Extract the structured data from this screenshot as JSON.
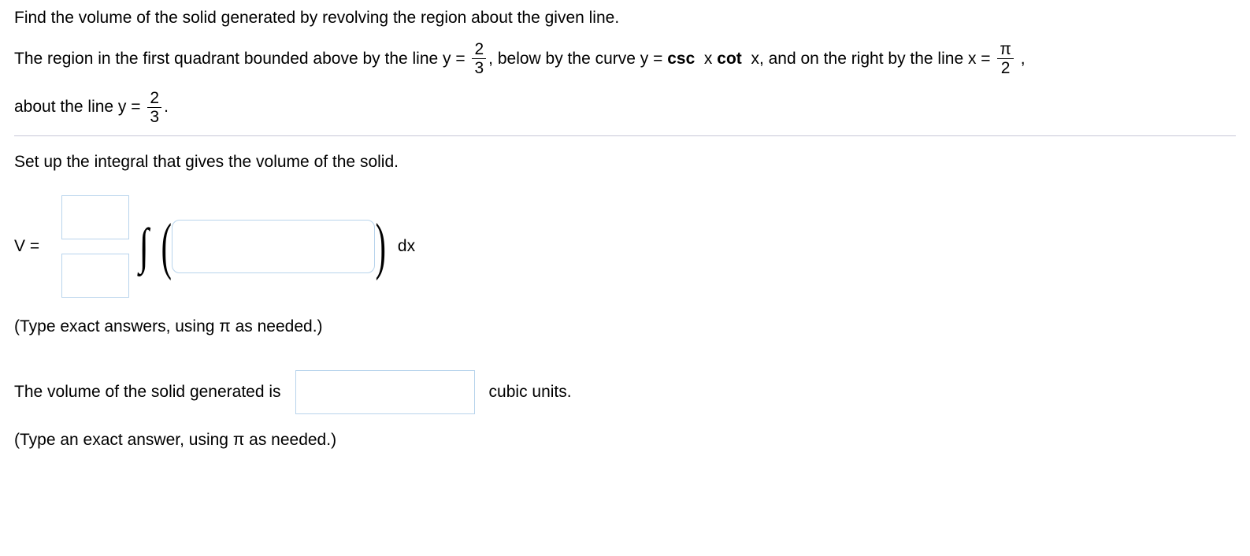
{
  "problem": {
    "intro": "Find the volume of the solid generated by revolving the region about the given line.",
    "text1": "The region in the first quadrant bounded above by the line y = ",
    "frac1_num": "2",
    "frac1_den": "3",
    "text2": ", below by the curve y = ",
    "csc": "csc ",
    "x1": " x ",
    "cot": "cot ",
    "x2": " x, and on the right by the line x = ",
    "frac2_num": "π",
    "frac2_den": "2",
    "text3": " ,",
    "text4": "about the line y = ",
    "frac3_num": "2",
    "frac3_den": "3",
    "text5": "."
  },
  "setup": {
    "instruction": "Set up the integral that gives the volume of the solid.",
    "v_label": "V =",
    "dx": " dx",
    "hint": "(Type exact answers, using π as needed.)"
  },
  "answer": {
    "text_before": "The volume of the solid generated is",
    "text_after": "cubic units.",
    "hint": "(Type an exact answer, using π as needed.)"
  }
}
